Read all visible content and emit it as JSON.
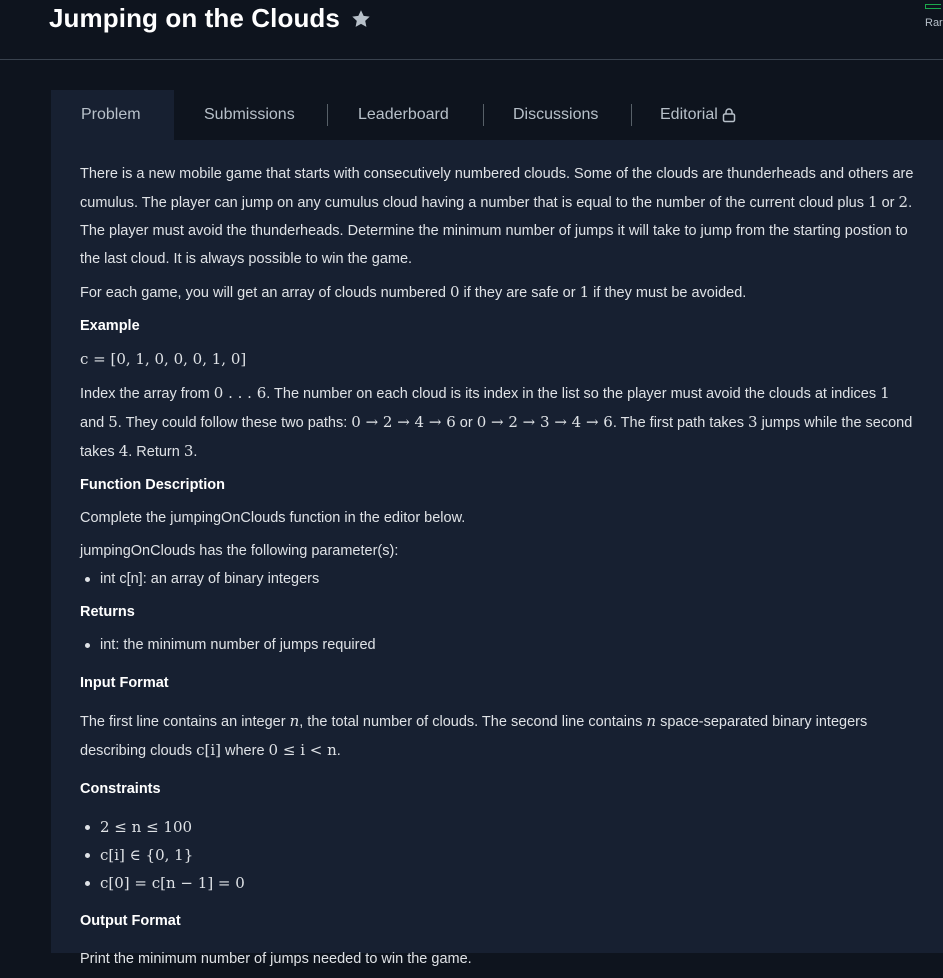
{
  "header": {
    "title": "Jumping on the Clouds",
    "rank_label": "Rar"
  },
  "tabs": [
    {
      "label": "Problem"
    },
    {
      "label": "Submissions"
    },
    {
      "label": "Leaderboard"
    },
    {
      "label": "Discussions"
    },
    {
      "label": "Editorial"
    }
  ],
  "content": {
    "p1a": "There is a new mobile game that starts with consecutively numbered clouds. Some of the clouds are thunderheads and others are cumulus. The player can jump on any cumulus cloud having a number that is equal to the number of the current cloud plus ",
    "p1_m1": "1",
    "p1b": " or ",
    "p1_m2": "2",
    "p1c": ". The player must avoid the thunderheads. Determine the minimum number of jumps it will take to jump from the starting postion to the last cloud. It is always possible to win the game.",
    "p2a": "For each game, you will get an array of clouds numbered ",
    "p2_m1": "0",
    "p2b": " if they are safe or ",
    "p2_m2": "1",
    "p2c": " if they must be avoided.",
    "example_heading": "Example",
    "example_math": "c = [0, 1, 0, 0, 0, 1, 0]",
    "p3a": "Index the array from ",
    "p3_m1": "0 . . . 6",
    "p3b": ". The number on each cloud is its index in the list so the player must avoid the clouds at indices ",
    "p3_m2": "1",
    "p3c": " and ",
    "p3_m3": "5",
    "p3d": ". They could follow these two paths: ",
    "p3_m4": "0 → 2 → 4 → 6",
    "p3e": " or ",
    "p3_m5": "0 → 2 → 3 → 4 → 6",
    "p3f": ". The first path takes ",
    "p3_m6": "3",
    "p3g": " jumps while the second takes ",
    "p3_m7": "4",
    "p3h": ". Return ",
    "p3_m8": "3",
    "p3i": ".",
    "func_heading": "Function Description",
    "func_p1": "Complete the jumpingOnClouds function in the editor below.",
    "func_p2": "jumpingOnClouds has the following parameter(s):",
    "func_param": "int c[n]: an array of binary integers",
    "returns_heading": "Returns",
    "returns_item": "int: the minimum number of jumps required",
    "input_heading": "Input Format",
    "input_a": "The first line contains an integer ",
    "input_m1": "n",
    "input_b": ", the total number of clouds. The second line contains ",
    "input_m2": "n",
    "input_c": " space-separated binary integers describing clouds ",
    "input_m3": "c[i]",
    "input_d": " where ",
    "input_m4": "0 ≤ i < n",
    "input_e": ".",
    "constraints_heading": "Constraints",
    "constraints": [
      "2 ≤ n ≤ 100",
      "c[i] ∈ {0, 1}",
      "c[0] = c[n − 1] = 0"
    ],
    "output_heading": "Output Format",
    "output_p": "Print the minimum number of jumps needed to win the game."
  }
}
